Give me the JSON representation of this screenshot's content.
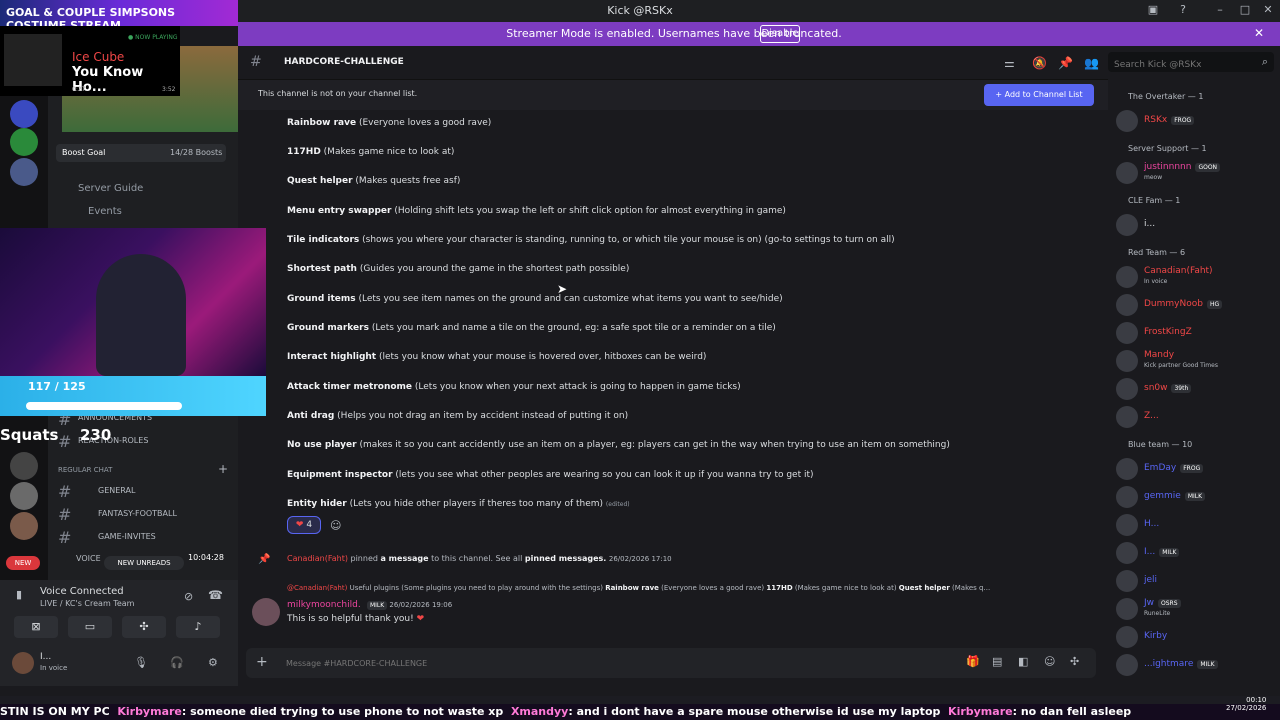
{
  "window": {
    "title": "Kick @RSKx"
  },
  "stream_overlay": {
    "title": "GOAL & COUPLE SIMPSONS COSTUME STREAM",
    "now_playing_flag": "● NOW PLAYING",
    "artist": "Ice Cube",
    "song": "You Know Ho...",
    "time_elapsed": "0:27",
    "time_total": "3:52",
    "hp_label": "117 / 125",
    "squats_label": "Squats",
    "squats_count": "230"
  },
  "streamer_bar": {
    "message": "Streamer Mode is enabled. Usernames have been truncated.",
    "disable_label": "Disable"
  },
  "sidebar": {
    "boost_goal": "Boost Goal",
    "boost_count": "14/28 Boosts",
    "server_guide": "Server Guide",
    "events": "Events",
    "announcements": "ANNOUNCEMENTS",
    "reaction_roles": "REACTION-ROLES",
    "category": "REGULAR CHAT",
    "channels": [
      "GENERAL",
      "FANTASY-FOOTBALL",
      "GAME-INVITES"
    ],
    "voice_label": "VOICE",
    "new_label": "NEW",
    "new_unreads": "NEW UNREADS",
    "unread_time": "10:04:28"
  },
  "voice": {
    "status": "Voice Connected",
    "channel": "LIVE / KC's Cream Team",
    "user_name": "I...",
    "user_status": "In voice"
  },
  "channel": {
    "name": "HARDCORE-CHALLENGE",
    "not_in_list": "This channel is not on your channel list.",
    "add_button": "Add to Channel List",
    "search_placeholder": "Search Kick @RSKx",
    "composer_placeholder": "Message #HARDCORE-CHALLENGE"
  },
  "plugins": [
    {
      "name": "Rainbow rave",
      "desc": "(Everyone loves a good rave)"
    },
    {
      "name": "117HD",
      "desc": "(Makes game nice to look at)"
    },
    {
      "name": "Quest helper",
      "desc": "(Makes quests free asf)"
    },
    {
      "name": "Menu entry swapper",
      "desc": "(Holding shift lets you swap the left or shift click option for almost everything in game)"
    },
    {
      "name": "Tile indicators",
      "desc": "(shows you where your character is standing, running to, or which tile your mouse is on) (go-to settings to turn on all)"
    },
    {
      "name": "Shortest path",
      "desc": "(Guides you around the game in the shortest path possible)"
    },
    {
      "name": "Ground items",
      "desc": "(Lets you see item names on the ground and can customize what items you want to see/hide)"
    },
    {
      "name": "Ground markers",
      "desc": "(Lets you mark and name a tile on the ground, eg: a safe spot tile or a reminder on a tile)"
    },
    {
      "name": "Interact highlight",
      "desc": "(lets you know what your mouse is hovered over, hitboxes can be weird)"
    },
    {
      "name": "Attack timer metronome",
      "desc": "(Lets you know when your next attack is going to happen in game ticks)"
    },
    {
      "name": "Anti drag",
      "desc": "(Helps you not drag an item by accident instead of putting it on)"
    },
    {
      "name": "No use player",
      "desc": "(makes it so you cant accidently use an item on a player, eg: players can get in the way when trying to use an item on something)"
    },
    {
      "name": "Equipment inspector",
      "desc": "(lets you see what other peoples are wearing so you can look it up if you wanna try to get it)"
    },
    {
      "name": "Entity hider",
      "desc": "(Lets you hide other players if theres too many of them)"
    }
  ],
  "edited_label": "(edited)",
  "reaction": {
    "emoji": "❤",
    "count": "4"
  },
  "pin": {
    "user": "Canadian(Faht)",
    "pinned": "pinned",
    "a_message": "a message",
    "to_channel": "to this channel. See all",
    "pinned_messages": "pinned messages.",
    "timestamp": "26/02/2026 17:10"
  },
  "reply": {
    "user": "@Canadian(Faht)",
    "text": "Useful plugins (Some plugins you need to play around with the settings)",
    "b1": "Rainbow rave",
    "t1": "(Everyone loves a good rave)",
    "b2": "117HD",
    "t2": "(Makes game nice to look at)",
    "b3": "Quest helper",
    "t3": "(Makes q..."
  },
  "message": {
    "author": "milkymoonchild.",
    "tag": "MILK",
    "timestamp": "26/02/2026 19:06",
    "text": "This is so helpful thank you!"
  },
  "members": {
    "groups": [
      {
        "label": "The Overtaker — 1",
        "users": [
          {
            "name": "RSKx",
            "tag": "FROG",
            "color": "#f04747"
          }
        ]
      },
      {
        "label": "Server Support — 1",
        "users": [
          {
            "name": "justinnnnn",
            "tag": "GOON",
            "status": "meow",
            "color": "#eb459e"
          }
        ]
      },
      {
        "label": "CLE Fam — 1",
        "users": [
          {
            "name": "i...",
            "color": "#dbdee1"
          }
        ]
      },
      {
        "label": "Red Team — 6",
        "users": [
          {
            "name": "Canadian(Faht)",
            "status": "In voice",
            "color": "#f04747"
          },
          {
            "name": "DummyNoob",
            "tag": "HG",
            "color": "#f04747"
          },
          {
            "name": "FrostKingZ",
            "color": "#f04747"
          },
          {
            "name": "Mandy",
            "status": "Kick partner Good Times",
            "color": "#f04747"
          },
          {
            "name": "sn0w",
            "tag": "39th",
            "color": "#f04747"
          },
          {
            "name": "Z...",
            "color": "#f04747"
          }
        ]
      },
      {
        "label": "Blue team — 10",
        "users": [
          {
            "name": "EmDay",
            "tag": "FROG",
            "color": "#5865f2"
          },
          {
            "name": "gemmie",
            "tag": "MILK",
            "color": "#5865f2"
          },
          {
            "name": "H...",
            "color": "#5865f2"
          },
          {
            "name": "I...",
            "tag": "MILK",
            "color": "#5865f2"
          },
          {
            "name": "jeli",
            "color": "#5865f2"
          },
          {
            "name": "Jw",
            "tag": "OSRS",
            "status": "RuneLite",
            "color": "#5865f2"
          },
          {
            "name": "Kirby",
            "color": "#5865f2"
          },
          {
            "name": "...ightmare",
            "tag": "MILK",
            "color": "#5865f2"
          }
        ]
      }
    ]
  },
  "ticker": {
    "lead": "STIN IS ON MY PC",
    "u1": "Kirbymare",
    "m1": ": someone died trying to use phone to not waste xp",
    "u2": "Xmandyy",
    "m2": ": and i dont have a spare mouse otherwise id use my laptop",
    "u3": "Kirbymare",
    "m3": ": no dan fell asleep"
  },
  "clock": {
    "time": "00:10",
    "date": "27/02/2026"
  }
}
